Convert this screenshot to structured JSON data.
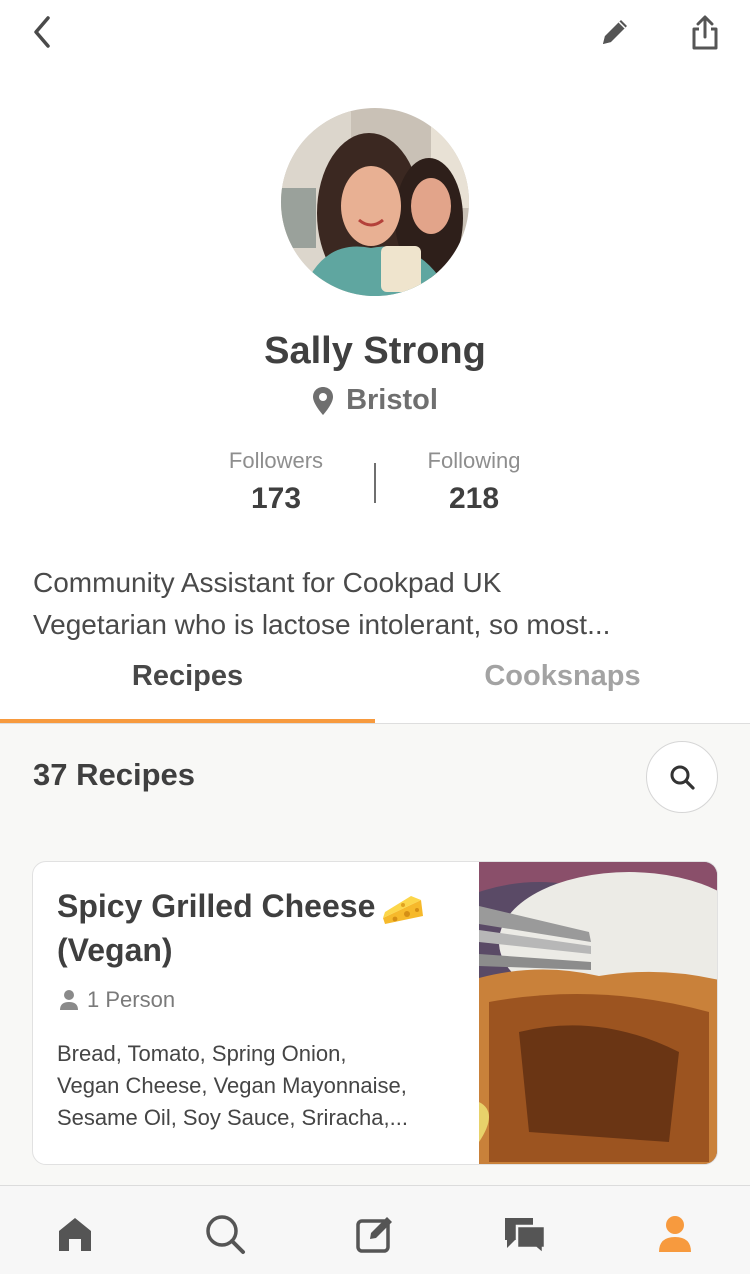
{
  "profile": {
    "name": "Sally Strong",
    "location": "Bristol",
    "followers_label": "Followers",
    "followers_count": "173",
    "following_label": "Following",
    "following_count": "218",
    "bio_lines": [
      "Community Assistant for Cookpad UK",
      "Vegetarian who is lactose intolerant, so most..."
    ]
  },
  "top_bar": {
    "icons": [
      "back-icon",
      "pencil-icon",
      "share-icon"
    ]
  },
  "tabs": [
    {
      "label": "Recipes",
      "active": true
    },
    {
      "label": "Cooksnaps",
      "active": false
    }
  ],
  "recipes": {
    "count_label": "37 Recipes",
    "items": [
      {
        "title_lines": [
          "Spicy Grilled Cheese",
          "(Vegan)"
        ],
        "servings": "1 Person",
        "ingredient_lines": [
          "Bread, Tomato, Spring Onion,",
          "Vegan Cheese, Vegan Mayonnaise,",
          "Sesame Oil, Soy Sauce, Sriracha,..."
        ]
      }
    ]
  },
  "bottom_nav": {
    "items": [
      "home-icon",
      "search-icon",
      "compose-icon",
      "chat-icon",
      "profile-icon"
    ],
    "active": "profile-icon"
  },
  "colors": {
    "accent": "#f79a3e",
    "text_dark": "#3f3f3f",
    "text_muted": "#8e8e8e",
    "tab_inactive": "#a3a3a3"
  }
}
